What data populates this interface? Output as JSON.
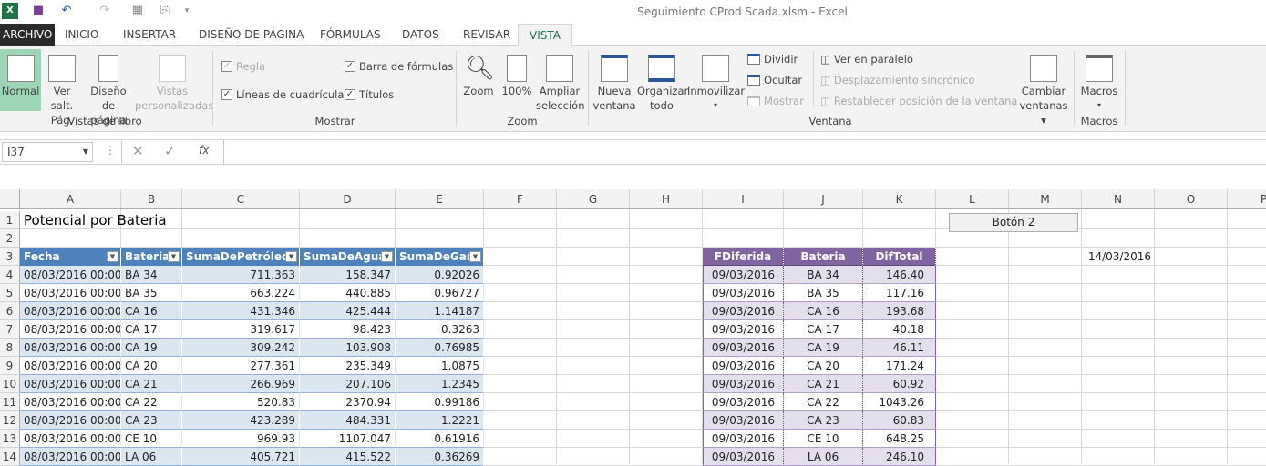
{
  "window": {
    "title": "Seguimiento CProd Scada.xlsm - Excel"
  },
  "tabs": [
    "ARCHIVO",
    "INICIO",
    "INSERTAR",
    "DISEÑO DE PÁGINA",
    "FÓRMULAS",
    "DATOS",
    "REVISAR",
    "VISTA"
  ],
  "active_tab": "VISTA",
  "ribbon": {
    "vistas_libro": {
      "label": "Vistas de libro",
      "buttons": [
        [
          "Normal",
          ""
        ],
        [
          "Ver salt.",
          "Pág."
        ],
        [
          "Diseño",
          "de página"
        ],
        [
          "Vistas",
          "personalizadas"
        ]
      ]
    },
    "mostrar": {
      "label": "Mostrar",
      "regla": "Regla",
      "barra": "Barra de fórmulas",
      "lineas": "Líneas de cuadrícula",
      "titulos": "Títulos"
    },
    "zoom": {
      "label": "Zoom",
      "zoom": "Zoom",
      "cien": "100%",
      "ampliar1": "Ampliar",
      "ampliar2": "selección"
    },
    "ventana": {
      "label": "Ventana",
      "nueva1": "Nueva",
      "nueva2": "ventana",
      "org1": "Organizar",
      "org2": "todo",
      "inmov": "Inmovilizar",
      "dividir": "Dividir",
      "ocultar": "Ocultar",
      "mostrar": "Mostrar",
      "paralelo": "Ver en paralelo",
      "desplaz": "Desplazamiento sincrónico",
      "restablecer": "Restablecer posición de la ventana",
      "cambiar1": "Cambiar",
      "cambiar2": "ventanas"
    },
    "macros": {
      "label": "Macros",
      "button": "Macros"
    }
  },
  "formula_bar": {
    "name_box": "I37",
    "fx": "fx",
    "value": ""
  },
  "columns": [
    "A",
    "B",
    "C",
    "D",
    "E",
    "F",
    "G",
    "H",
    "I",
    "J",
    "K",
    "L",
    "M",
    "N",
    "O",
    "P"
  ],
  "rows": [
    "1",
    "2",
    "3",
    "4",
    "5",
    "6",
    "7",
    "8",
    "9",
    "10",
    "11",
    "12",
    "13",
    "14"
  ],
  "sheet": {
    "title": "Potencial por Bateria",
    "button": "Botón 2",
    "date_n3": "14/03/2016",
    "table1": {
      "headers": [
        "Fecha",
        "Bateria",
        "SumaDePetróleo",
        "SumaDeAgua",
        "SumaDeGas"
      ],
      "rows": [
        [
          "08/03/2016 00:00",
          "BA 34",
          "711.363",
          "158.347",
          "0.92026"
        ],
        [
          "08/03/2016 00:00",
          "BA 35",
          "663.224",
          "440.885",
          "0.96727"
        ],
        [
          "08/03/2016 00:00",
          "CA 16",
          "431.346",
          "425.444",
          "1.14187"
        ],
        [
          "08/03/2016 00:00",
          "CA 17",
          "319.617",
          "98.423",
          "0.3263"
        ],
        [
          "08/03/2016 00:00",
          "CA 19",
          "309.242",
          "103.908",
          "0.76985"
        ],
        [
          "08/03/2016 00:00",
          "CA 20",
          "277.361",
          "235.349",
          "1.0875"
        ],
        [
          "08/03/2016 00:00",
          "CA 21",
          "266.969",
          "207.106",
          "1.2345"
        ],
        [
          "08/03/2016 00:00",
          "CA 22",
          "520.83",
          "2370.94",
          "0.99186"
        ],
        [
          "08/03/2016 00:00",
          "CA 23",
          "423.289",
          "484.331",
          "1.2221"
        ],
        [
          "08/03/2016 00:00",
          "CE 10",
          "969.93",
          "1107.047",
          "0.61916"
        ],
        [
          "08/03/2016 00:00",
          "LA 06",
          "405.721",
          "415.522",
          "0.36269"
        ]
      ]
    },
    "table2": {
      "headers": [
        "FDiferida",
        "Bateria",
        "DifTotal"
      ],
      "rows": [
        [
          "09/03/2016",
          "BA 34",
          "146.40"
        ],
        [
          "09/03/2016",
          "BA 35",
          "117.16"
        ],
        [
          "09/03/2016",
          "CA 16",
          "193.68"
        ],
        [
          "09/03/2016",
          "CA 17",
          "40.18"
        ],
        [
          "09/03/2016",
          "CA 19",
          "46.11"
        ],
        [
          "09/03/2016",
          "CA 20",
          "171.24"
        ],
        [
          "09/03/2016",
          "CA 21",
          "60.92"
        ],
        [
          "09/03/2016",
          "CA 22",
          "1043.26"
        ],
        [
          "09/03/2016",
          "CA 23",
          "60.83"
        ],
        [
          "09/03/2016",
          "CE 10",
          "648.25"
        ],
        [
          "09/03/2016",
          "LA 06",
          "246.10"
        ]
      ]
    }
  },
  "colors": {
    "table1_header": "#4f81bd",
    "table1_band": "#dce6f1",
    "table2_header": "#8064a2",
    "table2_band": "#e4dfec",
    "accent": "#217346"
  }
}
